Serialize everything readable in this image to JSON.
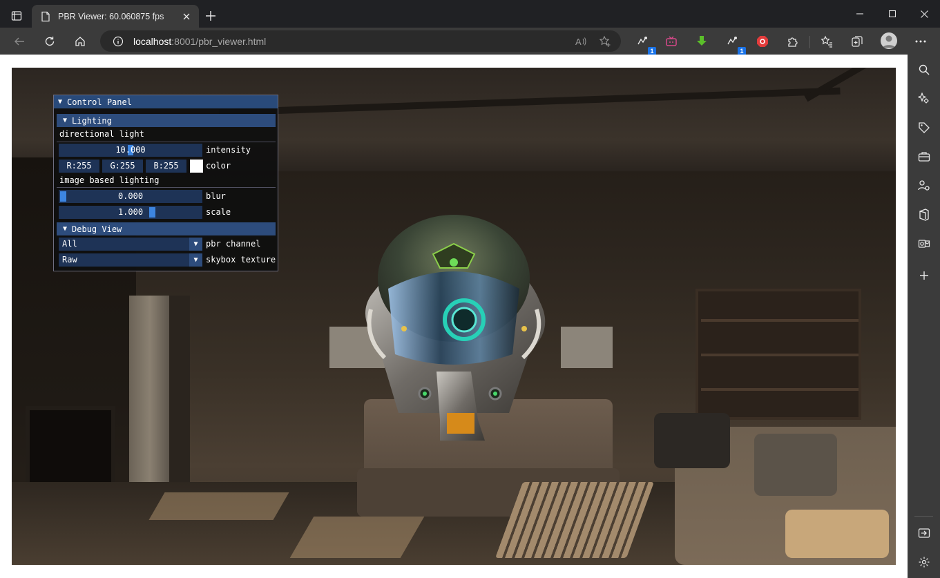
{
  "browser": {
    "tab": {
      "title": "PBR Viewer: 60.060875 fps"
    },
    "address": {
      "host": "localhost",
      "port_path": ":8001/pbr_viewer.html"
    },
    "colors": {
      "chrome_dark": "#202124",
      "chrome": "#3b3b3b",
      "accent": "#1a73e8"
    },
    "extensions": [
      {
        "icon": "extension-cloud-icon",
        "badge": "1"
      },
      {
        "icon": "extension-tv-icon"
      },
      {
        "icon": "download-arrow-icon"
      },
      {
        "icon": "extension-cloud-icon",
        "badge": "1"
      },
      {
        "icon": "shield-stop-icon"
      }
    ]
  },
  "panel": {
    "title": "Control Panel",
    "lighting": {
      "header": "Lighting",
      "directional_label": "directional light",
      "intensity": {
        "value": "10.000",
        "label": "intensity"
      },
      "color": {
        "r": "R:255",
        "g": "G:255",
        "b": "B:255",
        "label": "color",
        "swatch": "#ffffff"
      },
      "ibl_label": "image based lighting",
      "blur": {
        "value": "0.000",
        "label": "blur",
        "fraction": 0.0
      },
      "scale": {
        "value": "1.000",
        "label": "scale",
        "fraction": 0.66
      }
    },
    "debug": {
      "header": "Debug View",
      "pbr_channel": {
        "value": "All",
        "label": "pbr channel"
      },
      "skybox_texture": {
        "value": "Raw",
        "label": "skybox texture"
      }
    }
  },
  "sidebar": {
    "icons": [
      "search-icon",
      "copilot-sparkle-icon",
      "tag-icon",
      "toolbox-icon",
      "people-settings-icon",
      "office-icon",
      "outlook-icon",
      "add-icon",
      "exit-panel-icon",
      "settings-gear-icon"
    ]
  }
}
